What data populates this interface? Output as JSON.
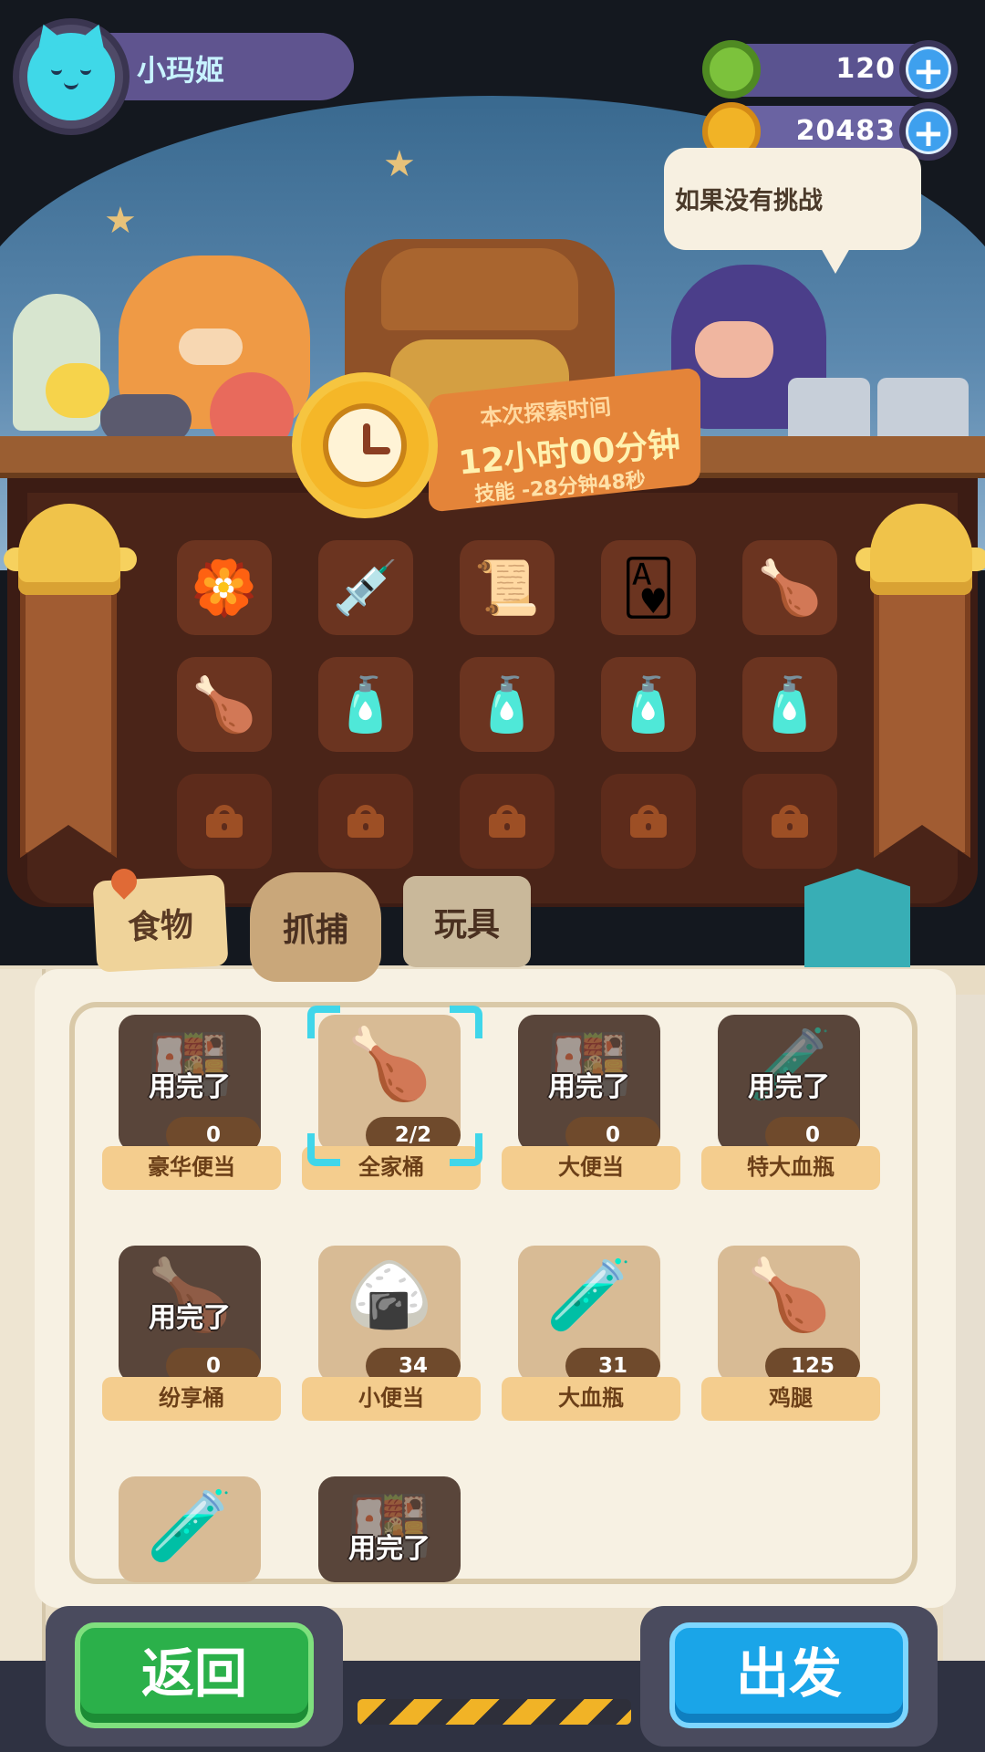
{
  "player": {
    "name": "小玛姬",
    "avatar_icon": "cat-face-icon"
  },
  "resources": [
    {
      "id": "gems",
      "icon": "green-donut-gem-icon",
      "value": "120",
      "color": "#7cc23c"
    },
    {
      "id": "coins",
      "icon": "gold-coin-icon",
      "value": "20483",
      "color": "#f1b326"
    }
  ],
  "speech_bubble": {
    "text": "如果没有挑战"
  },
  "exploration": {
    "title": "本次探索时间",
    "duration": "12小时00分钟",
    "skill_bonus": "技能 -28分钟48秒"
  },
  "inventory_slots": [
    {
      "icon": "green-badge-icon",
      "emoji": "🏵️",
      "locked": false
    },
    {
      "icon": "dropper-icon",
      "emoji": "💉",
      "locked": false
    },
    {
      "icon": "order-document-icon",
      "emoji": "📜",
      "locked": false
    },
    {
      "icon": "heart-card-icon",
      "emoji": "🂱",
      "locked": false
    },
    {
      "icon": "chicken-bucket-icon",
      "emoji": "🍗",
      "locked": false
    },
    {
      "icon": "chicken-bucket-icon",
      "emoji": "🍗",
      "locked": false
    },
    {
      "icon": "potion-bottle-icon",
      "emoji": "🧴",
      "locked": false
    },
    {
      "icon": "potion-bottle-icon",
      "emoji": "🧴",
      "locked": false
    },
    {
      "icon": "potion-bottle-icon",
      "emoji": "🧴",
      "locked": false
    },
    {
      "icon": "potion-bottle-icon",
      "emoji": "🧴",
      "locked": false
    },
    {
      "icon": "lock-icon",
      "locked": true
    },
    {
      "icon": "lock-icon",
      "locked": true
    },
    {
      "icon": "lock-icon",
      "locked": true
    },
    {
      "icon": "lock-icon",
      "locked": true
    },
    {
      "icon": "lock-icon",
      "locked": true
    }
  ],
  "tabs": [
    {
      "id": "food",
      "label": "食物",
      "active": true
    },
    {
      "id": "catch",
      "label": "抓捕",
      "active": false
    },
    {
      "id": "toy",
      "label": "玩具",
      "active": false
    }
  ],
  "items": [
    {
      "name": "豪华便当",
      "count": "0",
      "depleted": true,
      "used_label": "用完了",
      "emoji": "🍱",
      "selected": false
    },
    {
      "name": "全家桶",
      "count": "2/2",
      "depleted": false,
      "used_label": "",
      "emoji": "🍗",
      "selected": true
    },
    {
      "name": "大便当",
      "count": "0",
      "depleted": true,
      "used_label": "用完了",
      "emoji": "🍱",
      "selected": false
    },
    {
      "name": "特大血瓶",
      "count": "0",
      "depleted": true,
      "used_label": "用完了",
      "emoji": "🧪",
      "selected": false
    },
    {
      "name": "纷享桶",
      "count": "0",
      "depleted": true,
      "used_label": "用完了",
      "emoji": "🍗",
      "selected": false
    },
    {
      "name": "小便当",
      "count": "34",
      "depleted": false,
      "used_label": "",
      "emoji": "🍙",
      "selected": false
    },
    {
      "name": "大血瓶",
      "count": "31",
      "depleted": false,
      "used_label": "",
      "emoji": "🧪",
      "selected": false
    },
    {
      "name": "鸡腿",
      "count": "125",
      "depleted": false,
      "used_label": "",
      "emoji": "🍗",
      "selected": false
    },
    {
      "name": "",
      "count": "",
      "depleted": false,
      "used_label": "",
      "emoji": "🧪",
      "selected": false
    },
    {
      "name": "",
      "count": "",
      "depleted": true,
      "used_label": "用完了",
      "emoji": "🍱",
      "selected": false
    }
  ],
  "buttons": {
    "back_label": "返回",
    "go_label": "出发"
  },
  "colors": {
    "accent_green": "#2bb04a",
    "accent_blue": "#1aa5e8",
    "cabinet": "#3c1c14",
    "selection": "#40d6ea"
  }
}
